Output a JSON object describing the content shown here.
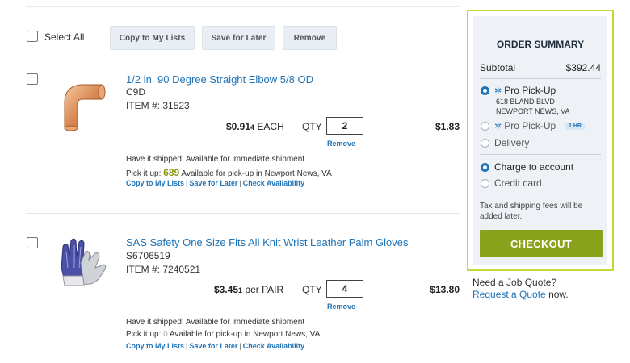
{
  "toolbar": {
    "select_all": "Select All",
    "copy_label": "Copy to My Lists",
    "save_label": "Save for Later",
    "remove_label": "Remove"
  },
  "items": [
    {
      "title": "1/2 in. 90 Degree Straight Elbow 5/8 OD",
      "sku": "C9D",
      "item_no": "ITEM #: 31523",
      "price_main": "$0.91",
      "price_small": "4",
      "unit": "EACH",
      "qty_label": "QTY",
      "qty": "2",
      "remove": "Remove",
      "total": "$1.83",
      "ship_text": "Have it shipped: Available for immediate shipment",
      "pick_prefix": "Pick it up: ",
      "pick_count": "689",
      "pick_suffix": " Available for pick-up in Newport News, VA",
      "link_copy": "Copy to My Lists",
      "link_save": "Save for Later",
      "link_check": "Check Availability"
    },
    {
      "title": "SAS Safety One Size Fits All Knit Wrist Leather Palm Gloves",
      "sku": "S6706519",
      "item_no": "ITEM #: 7240521",
      "price_main": "$3.45",
      "price_small": "1",
      "unit": "per PAIR",
      "qty_label": "QTY",
      "qty": "4",
      "remove": "Remove",
      "total": "$13.80",
      "ship_text": "Have it shipped: Available for immediate shipment",
      "pick_prefix": "Pick it up: ",
      "pick_count": "0",
      "pick_suffix": " Available for pick-up in Newport News, VA",
      "link_copy": "Copy to My Lists",
      "link_save": "Save for Later",
      "link_check": "Check Availability"
    }
  ],
  "summary": {
    "title": "ORDER SUMMARY",
    "subtotal_label": "Subtotal",
    "subtotal_value": "$392.44",
    "pickup_selected": "Pro Pick-Up",
    "pickup_address_line1": "618 BLAND BLVD",
    "pickup_address_line2": "NEWPORT NEWS, VA",
    "pickup_alt": "Pro Pick-Up",
    "pickup_alt_badge": "1 HR",
    "delivery": "Delivery",
    "charge_account": "Charge to account",
    "credit_card": "Credit card",
    "note": "Tax and shipping fees will be added later.",
    "checkout": "CHECKOUT"
  },
  "quote": {
    "question": "Need a Job Quote?",
    "link": "Request a Quote",
    "suffix": " now."
  },
  "colors": {
    "link": "#1f73b7",
    "checkout": "#8aa21b",
    "summary_border": "#c6d93a",
    "stock": "#8a9a12"
  }
}
